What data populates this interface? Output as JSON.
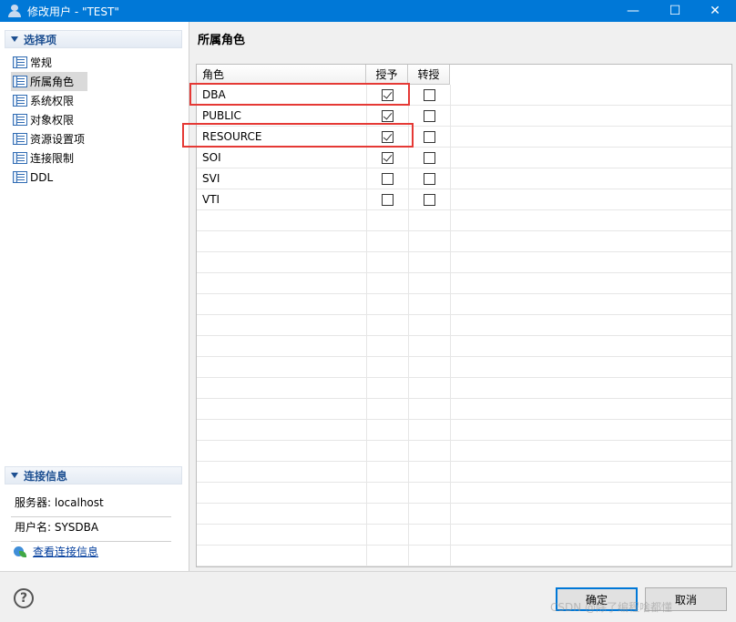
{
  "window": {
    "title": "修改用户 - \"TEST\"",
    "controls": {
      "minimize": "—",
      "maximize": "☐",
      "close": "✕"
    }
  },
  "sidebar": {
    "section_title": "选择项",
    "items": [
      {
        "label": "常规",
        "selected": false
      },
      {
        "label": "所属角色",
        "selected": true
      },
      {
        "label": "系统权限",
        "selected": false
      },
      {
        "label": "对象权限",
        "selected": false
      },
      {
        "label": "资源设置项",
        "selected": false
      },
      {
        "label": "连接限制",
        "selected": false
      },
      {
        "label": "DDL",
        "selected": false
      }
    ],
    "conn_section_title": "连接信息",
    "server": "服务器: localhost",
    "username": "用户名: SYSDBA",
    "view_conn_link": "查看连接信息"
  },
  "main": {
    "title": "所属角色",
    "columns": {
      "role": "角色",
      "grant": "授予",
      "regrant": "转授"
    },
    "rows": [
      {
        "name": "DBA",
        "grant": true,
        "regrant": false
      },
      {
        "name": "PUBLIC",
        "grant": true,
        "regrant": false
      },
      {
        "name": "RESOURCE",
        "grant": true,
        "regrant": false
      },
      {
        "name": "SOI",
        "grant": true,
        "regrant": false
      },
      {
        "name": "SVI",
        "grant": false,
        "regrant": false
      },
      {
        "name": "VTI",
        "grant": false,
        "regrant": false
      }
    ]
  },
  "footer": {
    "help": "?",
    "ok_label": "确定",
    "cancel_label": "取消",
    "watermark": "CSDN @除了编程啥都懂"
  },
  "colors": {
    "titlebar": "#0078d7",
    "highlight": "#e53935",
    "accent": "#1d4f91"
  }
}
